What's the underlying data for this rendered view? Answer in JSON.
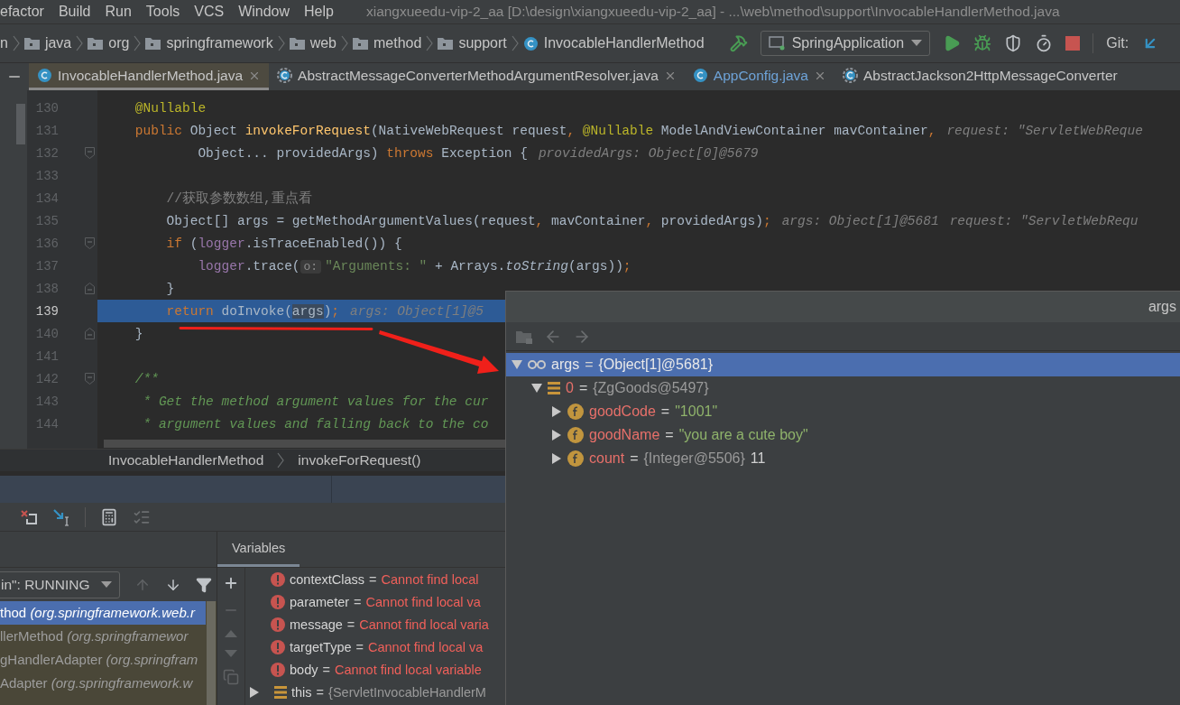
{
  "menu_bar": {
    "items": [
      "efactor",
      "Build",
      "Run",
      "Tools",
      "VCS",
      "Window",
      "Help"
    ],
    "title": "xiangxueedu-vip-2_aa [D:\\design\\xiangxueedu-vip-2_aa] - ...\\web\\method\\support\\InvocableHandlerMethod.java"
  },
  "navigation_bar": {
    "breadcrumbs": [
      {
        "label": "n",
        "kind": "text"
      },
      {
        "label": "java",
        "kind": "folder"
      },
      {
        "label": "org",
        "kind": "folder"
      },
      {
        "label": "springframework",
        "kind": "folder"
      },
      {
        "label": "web",
        "kind": "folder"
      },
      {
        "label": "method",
        "kind": "folder"
      },
      {
        "label": "support",
        "kind": "folder"
      },
      {
        "label": "InvocableHandlerMethod",
        "kind": "class"
      }
    ],
    "run_configuration": "SpringApplication",
    "vcs_label": "Git:"
  },
  "editor_tabs": [
    {
      "label": "InvocableHandlerMethod.java",
      "kind": "class",
      "selected": true,
      "modified": false,
      "closable": true
    },
    {
      "label": "AbstractMessageConverterMethodArgumentResolver.java",
      "kind": "abstract-class",
      "selected": false,
      "modified": false,
      "closable": true
    },
    {
      "label": "AppConfig.java",
      "kind": "class",
      "selected": false,
      "modified": true,
      "closable": true
    },
    {
      "label": "AbstractJackson2HttpMessageConverter",
      "kind": "abstract-class",
      "selected": false,
      "modified": false,
      "closable": false
    }
  ],
  "editor": {
    "lines": [
      {
        "number": "130",
        "current": false,
        "fold_start": false,
        "fold_end": false,
        "segments": [
          {
            "kind": "annotation",
            "text": "    @Nullable"
          }
        ]
      },
      {
        "number": "131",
        "current": false,
        "fold_start": false,
        "fold_end": false,
        "segments": [
          {
            "kind": "keyword",
            "text": "    public"
          },
          {
            "kind": "plain",
            "text": " Object "
          },
          {
            "kind": "method",
            "text": "invokeForRequest"
          },
          {
            "kind": "plain",
            "text": "(NativeWebRequest request"
          },
          {
            "kind": "keyword",
            "text": ","
          },
          {
            "kind": "annotation",
            "text": " @Nullable"
          },
          {
            "kind": "plain",
            "text": " ModelAndViewContainer mavContainer"
          },
          {
            "kind": "keyword",
            "text": ","
          }
        ],
        "hints": [
          "request: \"ServletWebReque"
        ]
      },
      {
        "number": "132",
        "current": false,
        "fold_start": true,
        "fold_end": false,
        "segments": [
          {
            "kind": "plain",
            "text": "            Object... providedArgs) "
          },
          {
            "kind": "keyword",
            "text": "throws"
          },
          {
            "kind": "plain",
            "text": " Exception {"
          }
        ],
        "hints": [
          "providedArgs: Object[0]@5679"
        ]
      },
      {
        "number": "133",
        "current": false,
        "fold_start": false,
        "fold_end": false
      },
      {
        "number": "134",
        "current": false,
        "fold_start": false,
        "fold_end": false,
        "segments": [
          {
            "kind": "comment",
            "text": "        //获取参数数组,重点看"
          }
        ]
      },
      {
        "number": "135",
        "current": false,
        "fold_start": false,
        "fold_end": false,
        "segments": [
          {
            "kind": "plain",
            "text": "        Object[] args = getMethodArgumentValues(request"
          },
          {
            "kind": "keyword",
            "text": ","
          },
          {
            "kind": "plain",
            "text": " mavContainer"
          },
          {
            "kind": "keyword",
            "text": ","
          },
          {
            "kind": "plain",
            "text": " providedArgs)"
          },
          {
            "kind": "keyword",
            "text": ";"
          }
        ],
        "hints": [
          "args: Object[1]@5681",
          "request: \"ServletWebRequ"
        ]
      },
      {
        "number": "136",
        "current": false,
        "fold_start": true,
        "fold_end": false,
        "segments": [
          {
            "kind": "keyword",
            "text": "        if"
          },
          {
            "kind": "plain",
            "text": " ("
          },
          {
            "kind": "field",
            "text": "logger"
          },
          {
            "kind": "plain",
            "text": ".isTraceEnabled()) {"
          }
        ]
      },
      {
        "number": "137",
        "current": false,
        "fold_start": false,
        "fold_end": false,
        "segments": [
          {
            "kind": "field",
            "text": "            logger"
          },
          {
            "kind": "plain",
            "text": ".trace("
          },
          {
            "kind": "param-hint",
            "text": "o:"
          },
          {
            "kind": "string",
            "text": "\"Arguments: \""
          },
          {
            "kind": "plain",
            "text": " + Arrays."
          },
          {
            "kind": "static",
            "text": "toString"
          },
          {
            "kind": "plain",
            "text": "(args))"
          },
          {
            "kind": "keyword",
            "text": ";"
          }
        ]
      },
      {
        "number": "138",
        "current": false,
        "fold_start": false,
        "fold_end": true,
        "segments": [
          {
            "kind": "plain",
            "text": "        }"
          }
        ]
      },
      {
        "number": "139",
        "current": true,
        "fold_start": false,
        "fold_end": false,
        "segments": [
          {
            "kind": "keyword",
            "text": "        return"
          },
          {
            "kind": "plain",
            "text": " doInvoke("
          },
          {
            "kind": "usage",
            "text": "args"
          },
          {
            "kind": "plain",
            "text": ")"
          },
          {
            "kind": "keyword",
            "text": ";"
          }
        ],
        "hints": [
          "args: Object[1]@5"
        ]
      },
      {
        "number": "140",
        "current": false,
        "fold_start": false,
        "fold_end": true,
        "segments": [
          {
            "kind": "plain",
            "text": "    }"
          }
        ]
      },
      {
        "number": "141",
        "current": false,
        "fold_start": false,
        "fold_end": false
      },
      {
        "number": "142",
        "current": false,
        "fold_start": true,
        "fold_end": false,
        "segments": [
          {
            "kind": "doc",
            "text": "    /**"
          }
        ]
      },
      {
        "number": "143",
        "current": false,
        "fold_start": false,
        "fold_end": false,
        "segments": [
          {
            "kind": "doc",
            "text": "     * Get the method argument values for the cur"
          }
        ]
      },
      {
        "number": "144",
        "current": false,
        "fold_start": false,
        "fold_end": false,
        "segments": [
          {
            "kind": "doc",
            "text": "     * argument values and falling back to the co"
          }
        ]
      }
    ],
    "breadcrumbs": [
      "InvocableHandlerMethod",
      "invokeForRequest()"
    ]
  },
  "debugger": {
    "thread_selector": "in\": RUNNING",
    "frames": [
      {
        "text": "thod *(org.springframework.web.r*",
        "selected": true
      },
      {
        "text": "llerMethod *(org.springframewor*",
        "selected": false
      },
      {
        "text": "gHandlerAdapter *(org.springfram*",
        "selected": false
      },
      {
        "text": "Adapter *(org.springframework.w*",
        "selected": false
      }
    ],
    "variables_tab": "Variables",
    "variables": [
      {
        "kind": "error",
        "name": "contextClass",
        "operator": "=",
        "value": "Cannot find local"
      },
      {
        "kind": "error",
        "name": "parameter",
        "operator": "=",
        "value": "Cannot find local va"
      },
      {
        "kind": "error",
        "name": "message",
        "operator": "=",
        "value": "Cannot find local varia"
      },
      {
        "kind": "error",
        "name": "targetType",
        "operator": "=",
        "value": "Cannot find local va"
      },
      {
        "kind": "error",
        "name": "body",
        "operator": "=",
        "value": "Cannot find local variable"
      },
      {
        "kind": "object",
        "name": "this",
        "operator": "=",
        "value": "{ServletInvocableHandlerM",
        "expanded": false
      }
    ]
  },
  "value_popup": {
    "title": "args",
    "tree": [
      {
        "kind": "watch",
        "name": "args",
        "operator": "=",
        "ref": "{Object[1]@5681}",
        "expanded": true,
        "selected": true,
        "children": [
          {
            "kind": "array",
            "name": "0",
            "operator": "=",
            "ref": "{ZgGoods@5497}",
            "expanded": true,
            "selected": false,
            "children": [
              {
                "kind": "field",
                "name": "goodCode",
                "operator": "=",
                "value": {
                  "kind": "string",
                  "text": "\"1001\""
                },
                "expanded": false,
                "selected": false
              },
              {
                "kind": "field",
                "name": "goodName",
                "operator": "=",
                "value": {
                  "kind": "string",
                  "text": "\"you are a cute boy\""
                },
                "expanded": false,
                "selected": false
              },
              {
                "kind": "field",
                "name": "count",
                "operator": "=",
                "ref": "{Integer@5506}",
                "value": {
                  "kind": "number",
                  "text": "11"
                },
                "expanded": false,
                "selected": false
              }
            ]
          }
        ]
      }
    ]
  }
}
